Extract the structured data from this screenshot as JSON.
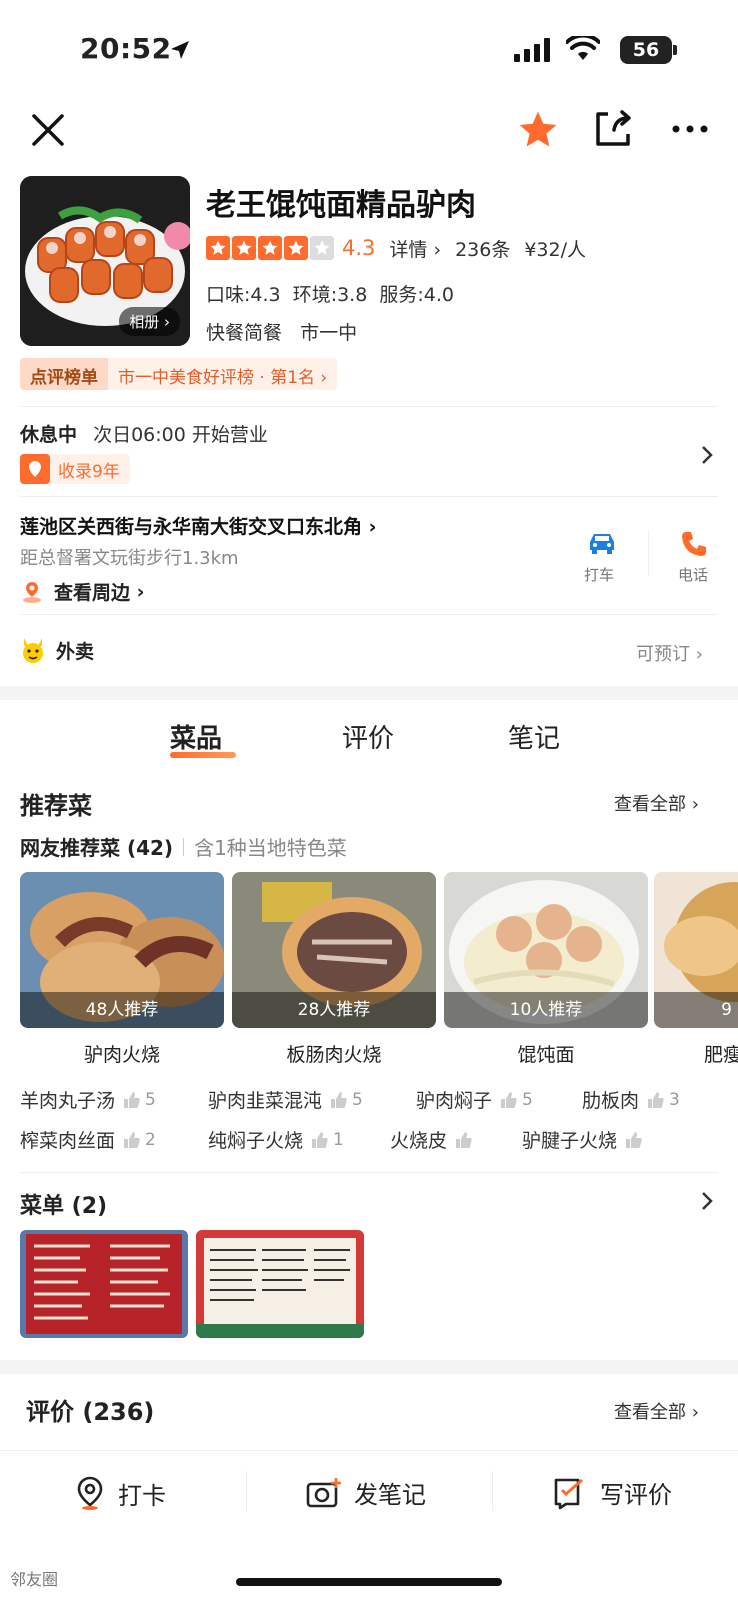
{
  "status": {
    "time": "20:52",
    "battery": "56"
  },
  "shop": {
    "title": "老王馄饨面精品驴肉",
    "album": "相册",
    "score": "4.3",
    "details": "详情",
    "reviews": "236条",
    "price": "¥32/人",
    "subscores": "口味:4.3  环境:3.8  服务:4.0",
    "category": "快餐简餐",
    "district": "市一中",
    "rank_label": "点评榜单",
    "rank_text": "市一中美食好评榜 · 第1名"
  },
  "hours": {
    "state": "休息中",
    "next": "次日06:00 开始营业",
    "badge": "收录9年"
  },
  "location": {
    "address": "莲池区关西街与永华南大街交叉口东北角",
    "distance": "距总督署文玩街步行1.3km",
    "nearby": "查看周边",
    "taxi": "打车",
    "phone": "电话"
  },
  "delivery": {
    "label": "外卖",
    "right": "可预订"
  },
  "tabs": [
    "菜品",
    "评价",
    "笔记"
  ],
  "recommend": {
    "title": "推荐菜",
    "see_all": "查看全部",
    "sub_title": "网友推荐菜 (42)",
    "sub_note": "含1种当地特色菜",
    "cards": [
      {
        "count": "48人推荐",
        "name": "驴肉火烧"
      },
      {
        "count": "28人推荐",
        "name": "板肠肉火烧"
      },
      {
        "count": "10人推荐",
        "name": "馄饨面"
      },
      {
        "count": "9",
        "name": "肥瘦"
      }
    ],
    "row1": [
      {
        "name": "羊肉丸子汤",
        "count": "5"
      },
      {
        "name": "驴肉韭菜混沌",
        "count": "5"
      },
      {
        "name": "驴肉焖子",
        "count": "5"
      },
      {
        "name": "肋板肉",
        "count": "3"
      }
    ],
    "row2": [
      {
        "name": "榨菜肉丝面",
        "count": "2"
      },
      {
        "name": "纯焖子火烧",
        "count": "1"
      },
      {
        "name": "火烧皮",
        "count": ""
      },
      {
        "name": "驴腱子火烧",
        "count": ""
      }
    ]
  },
  "menu": {
    "title": "菜单 (2)"
  },
  "reviews": {
    "title": "评价 (236)",
    "see_all": "查看全部"
  },
  "bottom": {
    "checkin": "打卡",
    "note": "发笔记",
    "review": "写评价"
  },
  "watermark": "邻友圈",
  "colors": {
    "accent": "#ff6b2c"
  }
}
